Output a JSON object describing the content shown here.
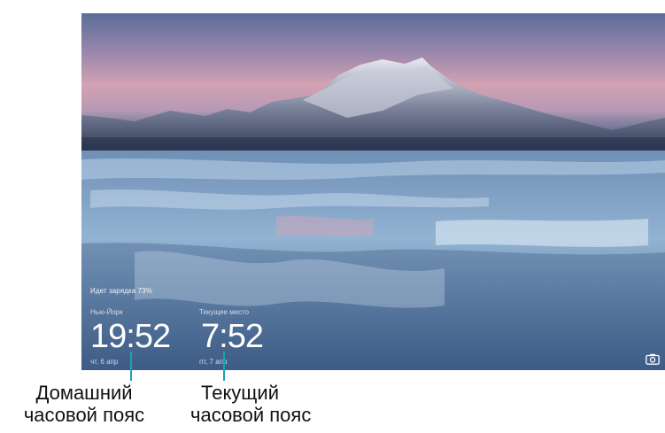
{
  "lock_screen": {
    "charging_text": "Идет зарядка 73%",
    "home_clock": {
      "city": "Нью-Йорк",
      "time": "19:52",
      "date": "чт, 6 апр"
    },
    "current_clock": {
      "city": "Текущее место",
      "time": "7:52",
      "date": "пт, 7 апр"
    },
    "camera_icon": "camera-icon"
  },
  "callouts": {
    "home_timezone_line1": "Домашний",
    "home_timezone_line2": "часовой пояс",
    "current_timezone_line1": "Текущий",
    "current_timezone_line2": "часовой пояс"
  },
  "colors": {
    "callout_line": "#1aa3b5",
    "clock_text": "#ffffff"
  }
}
